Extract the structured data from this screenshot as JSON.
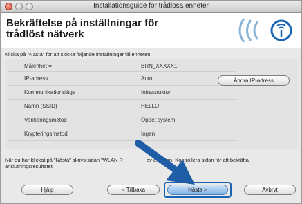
{
  "window": {
    "title": "Installationsguide för trådlösa enheter"
  },
  "header": {
    "title": "Bekräftelse på inställningar för trådlöst nätverk"
  },
  "instruction": "Klicka på \"Nästa\" för att skicka följande inställningar till enheten",
  "settings": [
    {
      "label": "Målenhet =",
      "value": "BRN_XXXXX1"
    },
    {
      "label": "IP-adress",
      "value": "Auto"
    },
    {
      "label": "Kommunikationsläge",
      "value": "Infrastruktur"
    },
    {
      "label": "Namn (SSID)",
      "value": "HELLO"
    },
    {
      "label": "Verifieringsmetod",
      "value": "Öppet system"
    },
    {
      "label": "Krypteringsmetod",
      "value": "Ingen"
    }
  ],
  "change_ip_button": "Ändra IP-adress",
  "footer_text_before": "När du har klickat på \"Nästa\" skrivs sidan \"WLAN R",
  "footer_text_after": "av enheten. Kontrollera sidan för att bekräfta anslutningsresultatet.",
  "buttons": {
    "help": "Hjälp",
    "back": "< Tillbaka",
    "next": "Nästa >",
    "cancel": "Avbryt"
  },
  "colors": {
    "accent": "#1a64b6",
    "arrow": "#1f5ea6"
  }
}
